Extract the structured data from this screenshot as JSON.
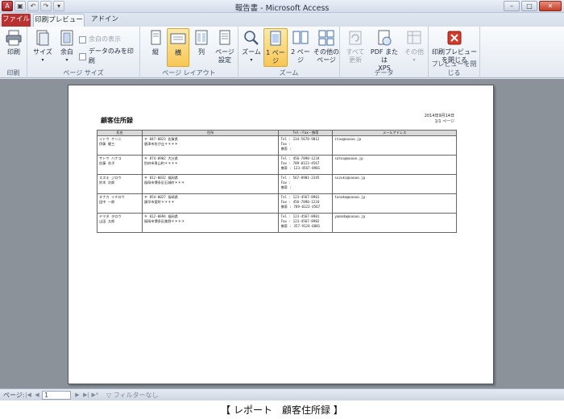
{
  "window": {
    "title": "報告書 - Microsoft Access",
    "minimize": "–",
    "maximize": "□",
    "close": "✕"
  },
  "tabs": {
    "file": "ファイル",
    "print_preview": "印刷プレビュー",
    "addin": "アドイン"
  },
  "ribbon": {
    "print_group": {
      "label": "印刷",
      "print": "印刷"
    },
    "page_size_group": {
      "label": "ページ サイズ",
      "size": "サイズ",
      "margins": "余白",
      "show_margins": "余白の表示",
      "print_data_only": "データのみを印刷"
    },
    "page_layout_group": {
      "label": "ページ レイアウト",
      "portrait": "縦",
      "landscape": "横",
      "columns": "列",
      "page_setup_1": "ページ",
      "page_setup_2": "設定"
    },
    "zoom_group": {
      "label": "ズーム",
      "zoom": "ズーム",
      "one_page": "1 ページ",
      "two_pages": "2 ページ",
      "more_pages_1": "その他の",
      "more_pages_2": "ページ"
    },
    "data_group": {
      "label": "データ",
      "refresh_1": "すべて",
      "refresh_2": "更新",
      "pdf_1": "PDF または",
      "pdf_2": "XPS",
      "more_1": "その他",
      "more_2": ""
    },
    "close_group": {
      "label": "プレビューを閉じる",
      "close_1": "印刷プレビュー",
      "close_2": "を閉じる"
    }
  },
  "report": {
    "title": "顧客住所録",
    "date": "2014年9月14日",
    "page": "1/1 ページ",
    "headers": [
      "氏名",
      "住所",
      "Tel・Fax・携帯",
      "メールアドレス"
    ],
    "rows": [
      {
        "kana": "イトウ ケンニ",
        "name": "伊藤 健三",
        "zip": "〒 847-0823 佐賀県",
        "addr": "唐津市佐が丘＊＊＊＊",
        "tel": "Tel : 234-5678-9012",
        "fax": "Fax :",
        "mobile": "携帯 :",
        "email": "itou@ooooo.jp"
      },
      {
        "kana": "サトウ ハナコ",
        "name": "佐藤 花子",
        "zip": "〒 874-0902 大分県",
        "addr": "別府市青山町＊＊＊＊",
        "tel": "Tel : 456-7890-1234",
        "fax": "Fax : 789-0123-4567",
        "mobile": "携帯 : 123-4567-8901",
        "email": "satou@ooooo.jp"
      },
      {
        "kana": "スズキ ジロウ",
        "name": "鈴木 次郎",
        "zip": "〒 812-0032 福岡県",
        "addr": "福岡市博多区石城町＊＊＊",
        "tel": "Tel : 567-8901-2345",
        "fax": "Fax :",
        "mobile": "携帯 :",
        "email": "suzuki@ooooo.jp"
      },
      {
        "kana": "タナカ イチロウ",
        "name": "田中 一郎",
        "zip": "〒 854-0027 長崎県",
        "addr": "諫早市愛町＊＊＊＊",
        "tel": "Tel : 123-4567-8901",
        "fax": "Fax : 456-7890-1234",
        "mobile": "携帯 : 789-0123-4567",
        "email": "tanaka@ooooo.jp"
      },
      {
        "kana": "ヤマダ タロウ",
        "name": "山田 太郎",
        "zip": "〒 812-0894 福岡県",
        "addr": "福岡市博多区美野＊＊＊＊",
        "tel": "Tel : 123-4567-8901",
        "fax": "Fax : 123-4567-8902",
        "mobile": "携帯 : 357-9124-6801",
        "email": "yamada@ooooo.jp"
      }
    ]
  },
  "status": {
    "page_label": "ページ:",
    "page_value": "1",
    "filter": "フィルターなし"
  },
  "caption": "【 レポート　顧客住所録 】"
}
